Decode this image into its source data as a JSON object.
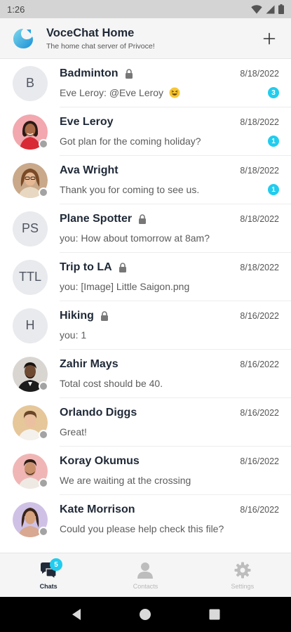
{
  "status_bar": {
    "time": "1:26"
  },
  "header": {
    "server_name": "VoceChat Home",
    "server_description": "The home chat server of Privoce!",
    "logo_icon": "vocechat-logo-icon",
    "add_icon": "plus-icon"
  },
  "colors": {
    "accent": "#22ccee",
    "header_bg": "#f5f5f5",
    "status_bar_bg": "#d4d4d4"
  },
  "chats": [
    {
      "name": "Badminton",
      "avatar": "B",
      "private": true,
      "date": "8/18/2022",
      "preview": "Eve Leroy:  @Eve Leroy",
      "unread": "3"
    },
    {
      "name": "Eve Leroy",
      "avatar": "photo",
      "private": false,
      "date": "8/18/2022",
      "preview": "Got plan for the coming holiday?",
      "unread": "1"
    },
    {
      "name": "Ava Wright",
      "avatar": "photo",
      "private": false,
      "date": "8/18/2022",
      "preview": "Thank you for coming to see us.",
      "unread": "1"
    },
    {
      "name": "Plane Spotter",
      "avatar": "PS",
      "private": true,
      "date": "8/18/2022",
      "preview": "you: How about tomorrow at 8am?",
      "unread": ""
    },
    {
      "name": "Trip to LA",
      "avatar": "TTL",
      "private": true,
      "date": "8/18/2022",
      "preview": "you: [Image] Little Saigon.png",
      "unread": ""
    },
    {
      "name": "Hiking",
      "avatar": "H",
      "private": true,
      "date": "8/16/2022",
      "preview": "you: 1",
      "unread": ""
    },
    {
      "name": "Zahir Mays",
      "avatar": "photo",
      "private": false,
      "date": "8/16/2022",
      "preview": "Total cost should be 40.",
      "unread": ""
    },
    {
      "name": "Orlando Diggs",
      "avatar": "photo",
      "private": false,
      "date": "8/16/2022",
      "preview": "Great!",
      "unread": ""
    },
    {
      "name": "Koray Okumus",
      "avatar": "photo",
      "private": false,
      "date": "8/16/2022",
      "preview": "We are waiting at the crossing",
      "unread": ""
    },
    {
      "name": "Kate Morrison",
      "avatar": "photo",
      "private": false,
      "date": "8/16/2022",
      "preview": "Could you please help check this file?",
      "unread": ""
    }
  ],
  "tabs": [
    {
      "label": "Chats",
      "icon": "chat-bubbles-icon",
      "badge": "5",
      "active": true
    },
    {
      "label": "Contacts",
      "icon": "person-icon",
      "active": false
    },
    {
      "label": "Settings",
      "icon": "gear-icon",
      "active": false
    }
  ],
  "nav_bar": {
    "back_icon": "back-triangle-icon",
    "home_icon": "home-circle-icon",
    "recents_icon": "recents-square-icon"
  }
}
